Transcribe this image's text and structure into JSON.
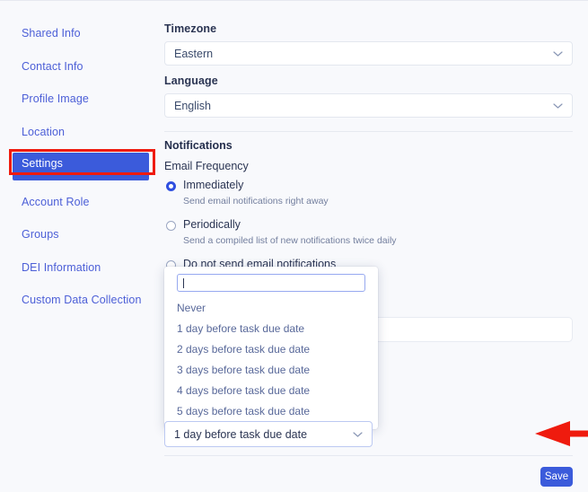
{
  "sidebar": {
    "items": [
      {
        "label": "Shared Info",
        "active": false
      },
      {
        "label": "Contact Info",
        "active": false
      },
      {
        "label": "Profile Image",
        "active": false
      },
      {
        "label": "Location",
        "active": false
      },
      {
        "label": "Settings",
        "active": true
      },
      {
        "label": "Account Role",
        "active": false
      },
      {
        "label": "Groups",
        "active": false
      },
      {
        "label": "DEI Information",
        "active": false
      },
      {
        "label": "Custom Data Collection",
        "active": false
      }
    ]
  },
  "form": {
    "timezone": {
      "label": "Timezone",
      "value": "Eastern"
    },
    "language": {
      "label": "Language",
      "value": "English"
    },
    "notifications_heading": "Notifications",
    "email_frequency": {
      "label": "Email Frequency",
      "options": [
        {
          "title": "Immediately",
          "description": "Send email notifications right away",
          "selected": true
        },
        {
          "title": "Periodically",
          "description": "Send a compiled list of new notifications twice daily",
          "selected": false
        },
        {
          "title": "Do not send email notifications",
          "description": "",
          "selected": false
        }
      ]
    },
    "text_input": {
      "value": "",
      "placeholder": ""
    },
    "due_date_select": {
      "value": "1 day before task due date"
    }
  },
  "dropdown": {
    "search": {
      "value": "",
      "placeholder": ""
    },
    "options": [
      "Never",
      "1 day before task due date",
      "2 days before task due date",
      "3 days before task due date",
      "4 days before task due date",
      "5 days before task due date"
    ]
  },
  "footer": {
    "save_label": "Save"
  },
  "annotations": {
    "highlight_color": "#ef1b0e",
    "arrow_color": "#ef1b0e",
    "active_nav_color": "#3b5bdb",
    "accent_color": "#3b5bdb"
  }
}
